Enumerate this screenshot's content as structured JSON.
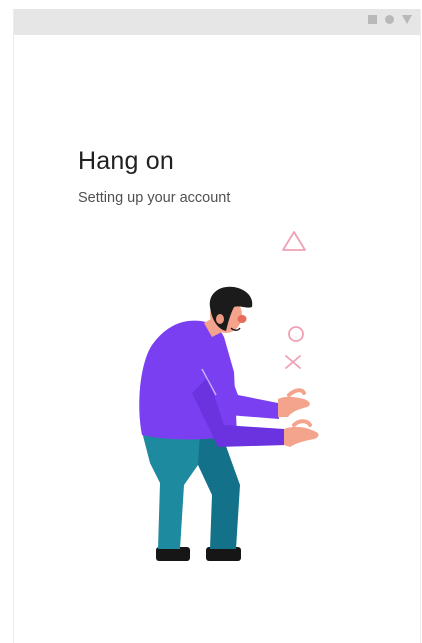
{
  "screen": {
    "title": "Hang on",
    "subtitle": "Setting up your account"
  },
  "status_bar": {
    "icons": [
      "square-icon",
      "circle-icon",
      "triangle-icon"
    ],
    "color": "#b9b9b9",
    "background": "#e6e6e6"
  },
  "illustration": {
    "shapes": [
      "triangle-shape",
      "circle-shape",
      "cross-shape"
    ],
    "colors": {
      "shapes": "#f0a1b4",
      "shirt": "#7b3ff2",
      "pants": "#1e8aa0",
      "skin": "#f4a48d",
      "hair": "#1b1b1b"
    }
  }
}
